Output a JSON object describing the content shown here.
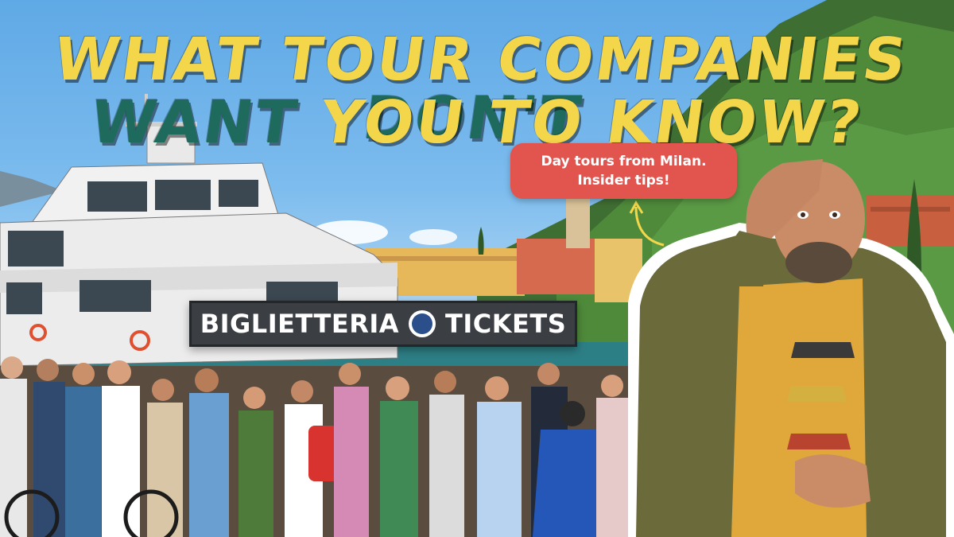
{
  "headline": {
    "line1_part1": "WHAT TOUR COMPANIES ",
    "line1_part2": "DON'T",
    "line2_part1": "WANT",
    "line2_part2": " YOU TO KNOW?"
  },
  "tip": {
    "line1": "Day tours from Milan.",
    "line2": "Insider tips!"
  },
  "sign": {
    "left": "BIGLIETTERIA",
    "right": "TICKETS"
  },
  "colors": {
    "yellow": "#f4d64b",
    "teal": "#1e6a5d",
    "bubble": "#e2554f"
  }
}
